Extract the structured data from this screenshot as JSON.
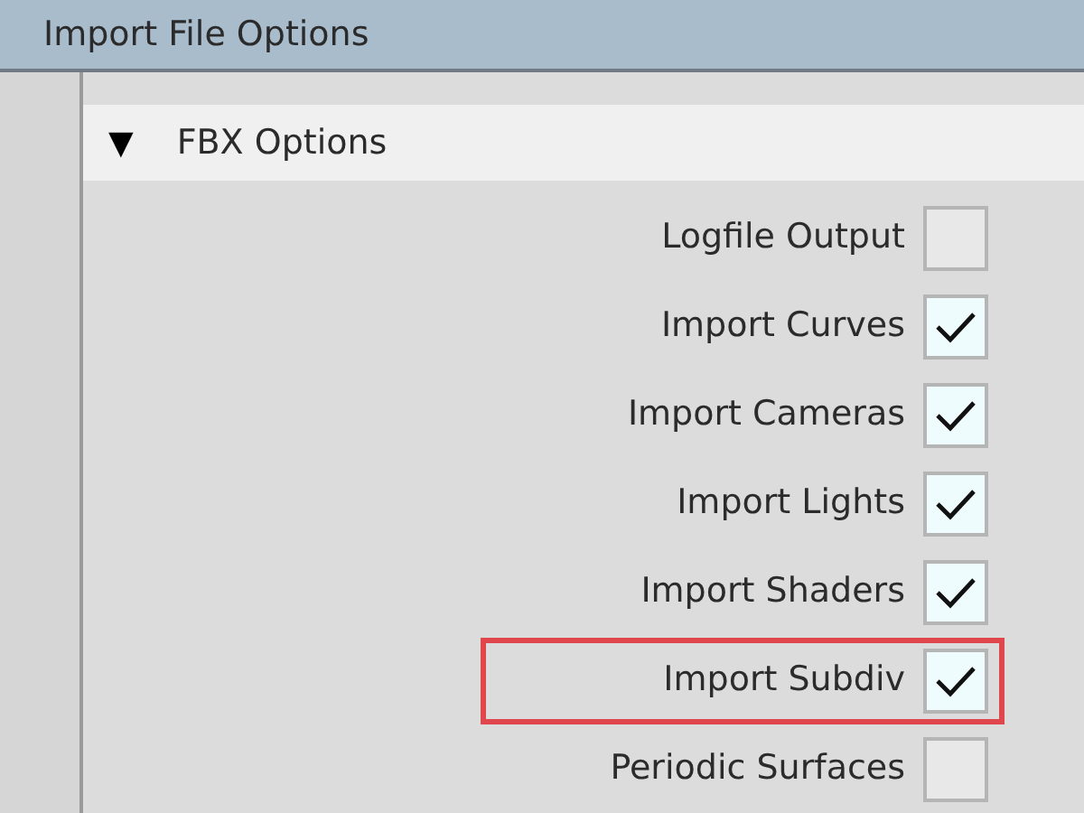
{
  "window": {
    "title": "Import File Options"
  },
  "section": {
    "title": "FBX Options",
    "expanded": true,
    "expander": "▼"
  },
  "options": [
    {
      "label": "Logfile Output",
      "checked": false,
      "highlighted": false
    },
    {
      "label": "Import Curves",
      "checked": true,
      "highlighted": false
    },
    {
      "label": "Import Cameras",
      "checked": true,
      "highlighted": false
    },
    {
      "label": "Import Lights",
      "checked": true,
      "highlighted": false
    },
    {
      "label": "Import Shaders",
      "checked": true,
      "highlighted": false
    },
    {
      "label": "Import Subdiv",
      "checked": true,
      "highlighted": true
    },
    {
      "label": "Periodic Surfaces",
      "checked": false,
      "highlighted": false
    }
  ]
}
